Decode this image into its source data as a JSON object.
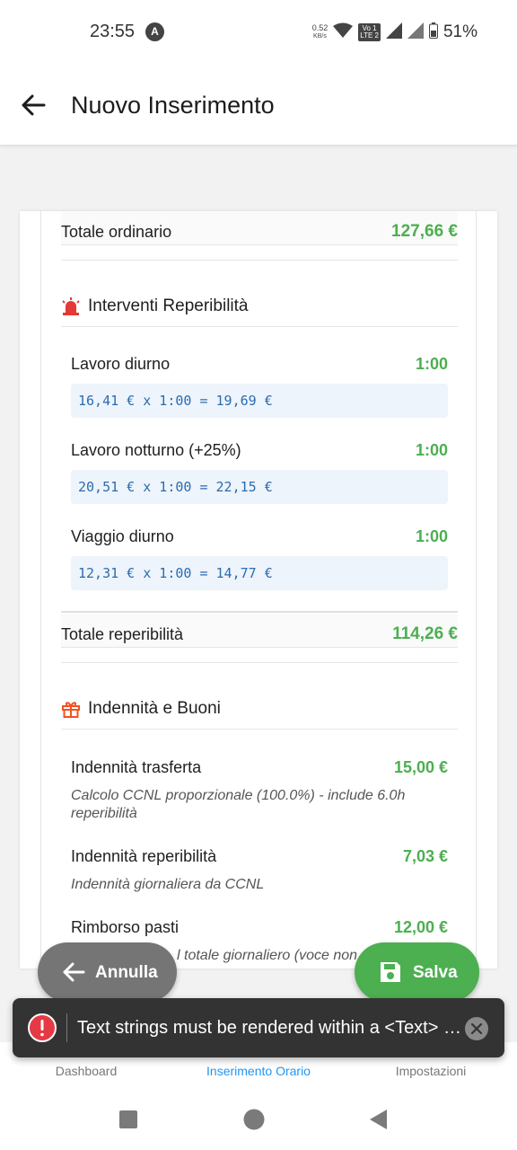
{
  "status_bar": {
    "time": "23:55",
    "app_icon_letter": "A",
    "net_speed_value": "0.52",
    "net_speed_unit": "KB/s",
    "volte_top": "Vo 1",
    "volte_bottom": "LTE 2",
    "battery": "51%"
  },
  "app_bar": {
    "title": "Nuovo Inserimento"
  },
  "summary": {
    "ordinary_label": "Totale ordinario",
    "ordinary_value": "127,66 €"
  },
  "reperibilita": {
    "title": "Interventi Reperibilità",
    "icon": "siren-icon",
    "items": [
      {
        "name": "Lavoro diurno",
        "hours": "1:00",
        "calc": "16,41 € x 1:00 = 19,69 €"
      },
      {
        "name": "Lavoro notturno (+25%)",
        "hours": "1:00",
        "calc": "20,51 € x 1:00 = 22,15 €"
      },
      {
        "name": "Viaggio diurno",
        "hours": "1:00",
        "calc": "12,31 € x 1:00 = 14,77 €"
      }
    ],
    "total_label": "Totale reperibilità",
    "total_value": "114,26 €"
  },
  "indennita": {
    "title": "Indennità e Buoni",
    "icon": "gift-icon",
    "items": [
      {
        "name": "Indennità trasferta",
        "amount": "15,00 €",
        "note": "Calcolo CCNL proporzionale (100.0%) - include 6.0h reperibilità"
      },
      {
        "name": "Indennità reperibilità",
        "amount": "7,03 €",
        "note": "Indennità giornaliera da CCNL"
      },
      {
        "name": "Rimborso pasti",
        "amount": "12,00 €",
        "note": "l totale giornaliero (voce non"
      }
    ]
  },
  "actions": {
    "cancel_label": "Annulla",
    "save_label": "Salva"
  },
  "toast": {
    "message": "Text strings must be rendered within a <Text> c..."
  },
  "bottom_nav": {
    "items": [
      {
        "label": "Dashboard",
        "icon": "bar-chart-icon",
        "active": false
      },
      {
        "label": "Inserimento Orario",
        "icon": "add-circle-icon",
        "active": true
      },
      {
        "label": "Impostazioni",
        "icon": "gear-icon",
        "active": false
      }
    ]
  },
  "colors": {
    "accent_green": "#4caf50",
    "accent_blue": "#2196f3",
    "calc_text": "#2b6cb0",
    "siren_red": "#e53935",
    "gift_orange": "#f4511e",
    "toast_bg": "#333333",
    "error_red": "#e53945"
  }
}
